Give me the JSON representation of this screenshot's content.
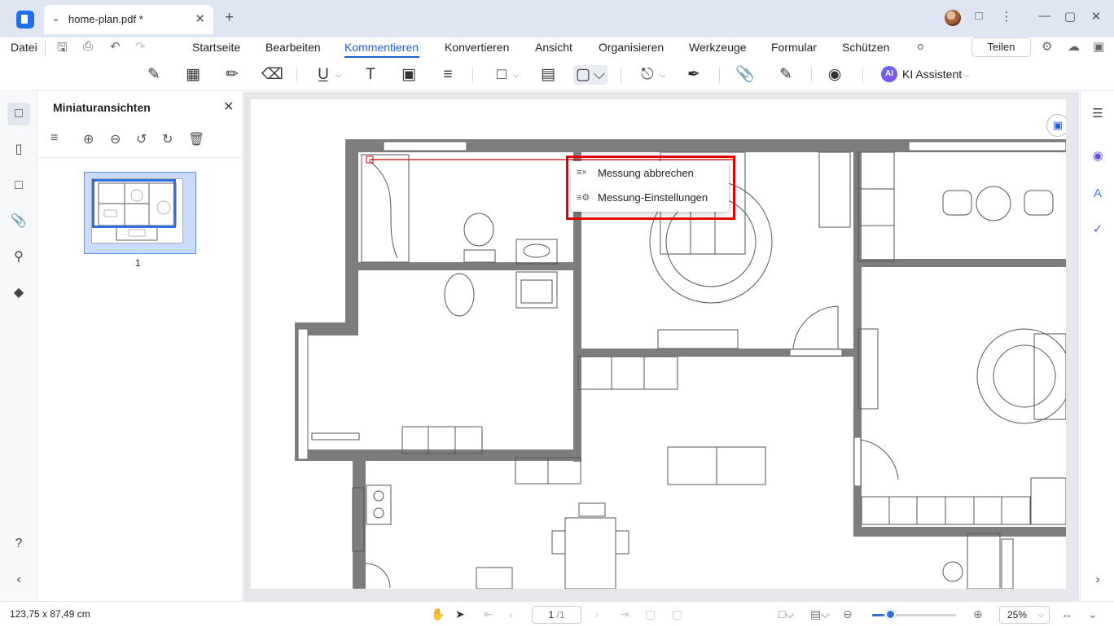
{
  "tab": {
    "title": "home-plan.pdf *"
  },
  "menu": {
    "file": "Datei",
    "items": [
      "Startseite",
      "Bearbeiten",
      "Kommentieren",
      "Konvertieren",
      "Ansicht",
      "Organisieren",
      "Werkzeuge",
      "Formular",
      "Schützen"
    ],
    "active": "Kommentieren",
    "share": "Teilen"
  },
  "toolbar": {
    "ai_badge": "AI",
    "ai_label": "KI Assistent"
  },
  "thumbnails": {
    "title": "Miniaturansichten",
    "page_number": "1"
  },
  "context_menu": {
    "items": [
      {
        "label": "Messung abbrechen",
        "icon": "cancel-measure-icon"
      },
      {
        "label": "Messung-Einstellungen",
        "icon": "measure-settings-icon"
      }
    ]
  },
  "status": {
    "coordinates": "123,75 x 87,49 cm",
    "page_current": "1",
    "page_total": "/1",
    "zoom": "25%",
    "zoom_level": 0.15
  },
  "colors": {
    "accent": "#1a5fd8",
    "highlight": "#e10000",
    "wall": "#7d7d7d"
  }
}
